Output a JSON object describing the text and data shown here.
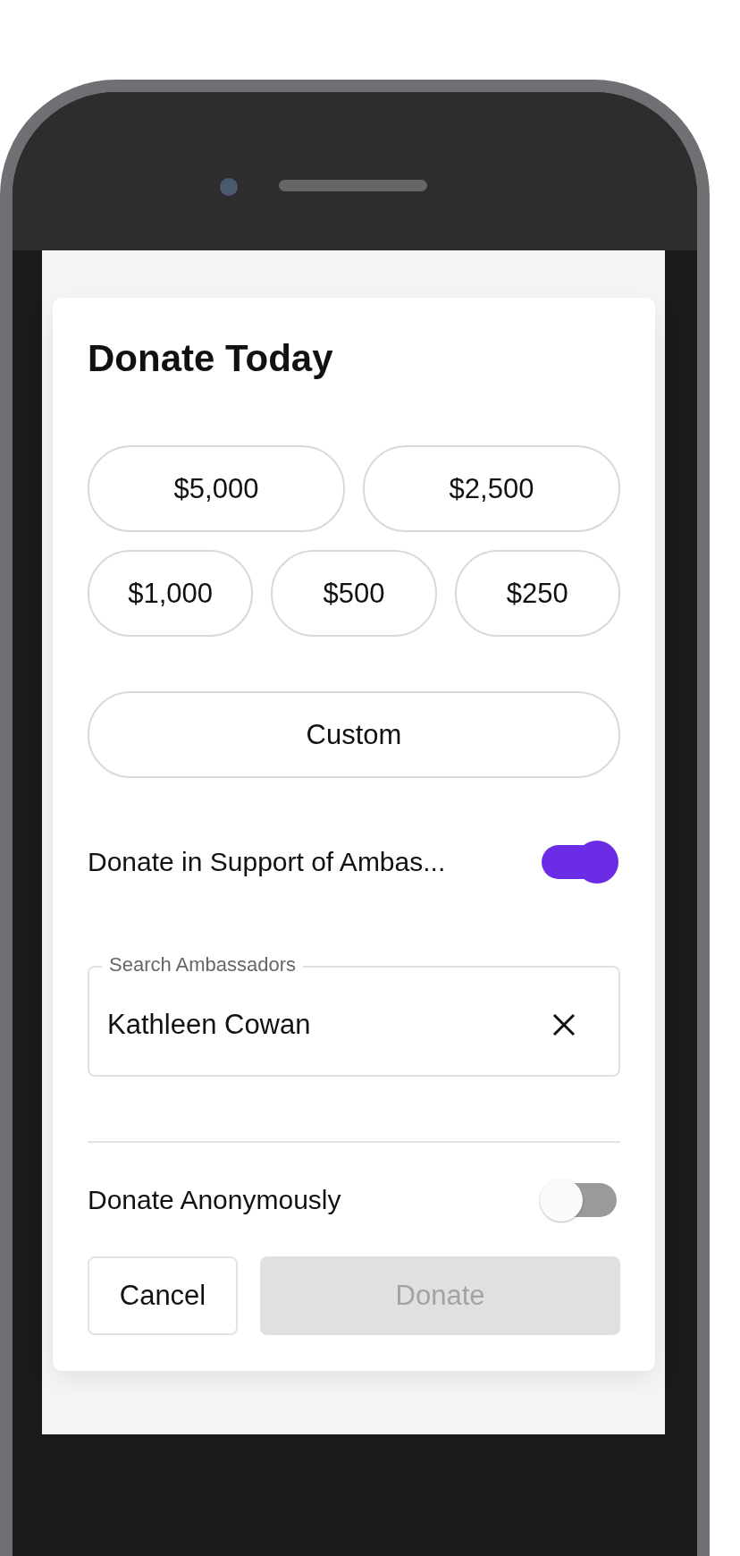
{
  "title": "Donate Today",
  "amount_rows": [
    {
      "options": [
        {
          "label": "$5,000",
          "selected": false
        },
        {
          "label": "$2,500",
          "selected": false
        }
      ]
    },
    {
      "options": [
        {
          "label": "$1,000",
          "selected": false
        },
        {
          "label": "$500",
          "selected": false
        },
        {
          "label": "$250",
          "selected": false
        }
      ]
    },
    {
      "options": [
        {
          "label": "Custom",
          "selected": false
        }
      ]
    }
  ],
  "support_toggle": {
    "label": "Donate in Support of Ambas...",
    "on": true
  },
  "ambassador_field": {
    "label": "Search Ambassadors",
    "value": "Kathleen Cowan"
  },
  "anonymous_toggle": {
    "label": "Donate Anonymously",
    "on": false
  },
  "buttons": {
    "cancel": {
      "label": "Cancel"
    },
    "donate": {
      "label": "Donate",
      "disabled": true
    }
  }
}
